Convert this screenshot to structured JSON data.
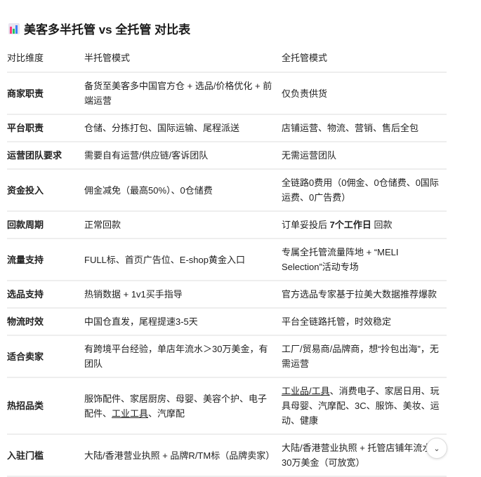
{
  "title": "美客多半托管 vs 全托管 对比表",
  "title_icon": "bar-chart-icon",
  "colors": {
    "icon_bars": [
      "#ff3b7f",
      "#22c55e",
      "#3b82f6"
    ]
  },
  "headers": [
    "对比维度",
    "半托管模式",
    "全托管模式"
  ],
  "rows": [
    [
      [
        {
          "t": "商家职责"
        }
      ],
      [
        {
          "t": "备货至美客多中国官方仓 + 选品/价格优化 + 前端运营"
        }
      ],
      [
        {
          "t": "仅负责供货"
        }
      ]
    ],
    [
      [
        {
          "t": "平台职责"
        }
      ],
      [
        {
          "t": "仓储、分拣打包、国际运输、尾程派送"
        }
      ],
      [
        {
          "t": "店铺运营、物流、营销、售后全包"
        }
      ]
    ],
    [
      [
        {
          "t": "运营团队要求"
        }
      ],
      [
        {
          "t": "需要自有运营/供应链/客诉团队"
        }
      ],
      [
        {
          "t": "无需运营团队"
        }
      ]
    ],
    [
      [
        {
          "t": "资金投入"
        }
      ],
      [
        {
          "t": "佣金减免（最高50%）、0仓储费"
        }
      ],
      [
        {
          "t": "全链路0费用（0佣金、0仓储费、0国际运费、0广告费）"
        }
      ]
    ],
    [
      [
        {
          "t": "回款周期"
        }
      ],
      [
        {
          "t": "正常回款"
        }
      ],
      [
        {
          "t": "订单妥投后 "
        },
        {
          "t": "7个工作日",
          "b": true
        },
        {
          "t": " 回款"
        }
      ]
    ],
    [
      [
        {
          "t": "流量支持"
        }
      ],
      [
        {
          "t": "FULL标、首页广告位、E-shop黄金入口"
        }
      ],
      [
        {
          "t": "专属全托管流量阵地 + “MELI Selection”活动专场"
        }
      ]
    ],
    [
      [
        {
          "t": "选品支持"
        }
      ],
      [
        {
          "t": "热销数据 + 1v1买手指导"
        }
      ],
      [
        {
          "t": "官方选品专家基于拉美大数据推荐爆款"
        }
      ]
    ],
    [
      [
        {
          "t": "物流时效"
        }
      ],
      [
        {
          "t": "中国仓直发，尾程提速3-5天"
        }
      ],
      [
        {
          "t": "平台全链路托管，时效稳定"
        }
      ]
    ],
    [
      [
        {
          "t": "适合卖家"
        }
      ],
      [
        {
          "t": "有跨境平台经验，单店年流水＞30万美金，有团队"
        }
      ],
      [
        {
          "t": "工厂/贸易商/品牌商，想“拎包出海”，无需运营"
        }
      ]
    ],
    [
      [
        {
          "t": "热招品类"
        }
      ],
      [
        {
          "t": "服饰配件、家居厨房、母婴、美容个护、电子配件、"
        },
        {
          "t": "工业工具",
          "u": true
        },
        {
          "t": "、汽摩配"
        }
      ],
      [
        {
          "t": "工业品/工具",
          "u": true
        },
        {
          "t": "、消费电子、家居日用、玩具母婴、汽摩配、3C、服饰、美妆、运动、健康"
        }
      ]
    ],
    [
      [
        {
          "t": "入驻门槛"
        }
      ],
      [
        {
          "t": "大陆/香港营业执照 + 品牌R/TM标（品牌卖家）"
        }
      ],
      [
        {
          "t": "大陆/香港营业执照 + 托管店铺年流水＞30万美金（可放宽）"
        }
      ]
    ]
  ],
  "scroll_icon": "chevron-down-icon",
  "scroll_glyph": "⌄"
}
